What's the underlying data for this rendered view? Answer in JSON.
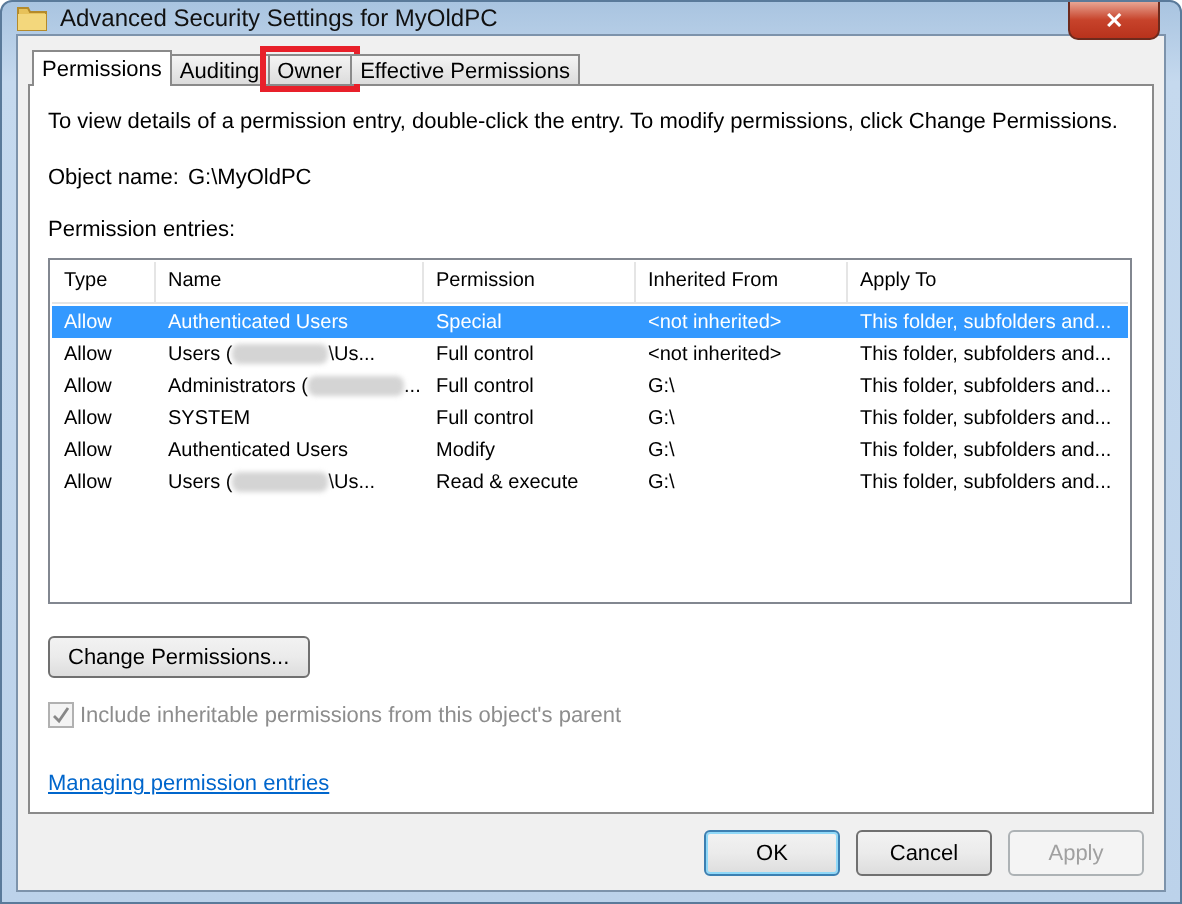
{
  "window": {
    "title": "Advanced Security Settings for MyOldPC",
    "close": "✕"
  },
  "tabs": [
    {
      "label": "Permissions",
      "selected": true,
      "highlighted": false
    },
    {
      "label": "Auditing",
      "selected": false,
      "highlighted": false
    },
    {
      "label": "Owner",
      "selected": false,
      "highlighted": true
    },
    {
      "label": "Effective Permissions",
      "selected": false,
      "highlighted": false
    }
  ],
  "instructions": "To view details of a permission entry, double-click the entry. To modify permissions, click Change Permissions.",
  "object_name": {
    "label": "Object name:",
    "value": "G:\\MyOldPC"
  },
  "entries_label": "Permission entries:",
  "table": {
    "columns": [
      "Type",
      "Name",
      "Permission",
      "Inherited From",
      "Apply To"
    ],
    "rows": [
      {
        "selected": true,
        "cells": [
          "Allow",
          "Authenticated Users",
          "Special",
          "<not inherited>",
          "This folder, subfolders and..."
        ],
        "redacted_name": false,
        "name_end": ""
      },
      {
        "selected": false,
        "cells": [
          "Allow",
          "Users (",
          "Full control",
          "<not inherited>",
          "This folder, subfolders and..."
        ],
        "redacted_name": true,
        "name_end": "\\Us..."
      },
      {
        "selected": false,
        "cells": [
          "Allow",
          "Administrators (",
          "Full control",
          "G:\\",
          "This folder, subfolders and..."
        ],
        "redacted_name": true,
        "name_end": "..."
      },
      {
        "selected": false,
        "cells": [
          "Allow",
          "SYSTEM",
          "Full control",
          "G:\\",
          "This folder, subfolders and..."
        ],
        "redacted_name": false,
        "name_end": ""
      },
      {
        "selected": false,
        "cells": [
          "Allow",
          "Authenticated Users",
          "Modify",
          "G:\\",
          "This folder, subfolders and..."
        ],
        "redacted_name": false,
        "name_end": ""
      },
      {
        "selected": false,
        "cells": [
          "Allow",
          "Users (",
          "Read & execute",
          "G:\\",
          "This folder, subfolders and..."
        ],
        "redacted_name": true,
        "name_end": "\\Us..."
      }
    ]
  },
  "change_button": "Change Permissions...",
  "inherit_checkbox": {
    "label": "Include inheritable permissions from this object's parent",
    "checked": true,
    "disabled": true
  },
  "help_link": "Managing permission entries",
  "buttons": [
    {
      "label": "OK",
      "disabled": false,
      "default": true
    },
    {
      "label": "Cancel",
      "disabled": false,
      "default": false
    },
    {
      "label": "Apply",
      "disabled": true,
      "default": false
    }
  ]
}
